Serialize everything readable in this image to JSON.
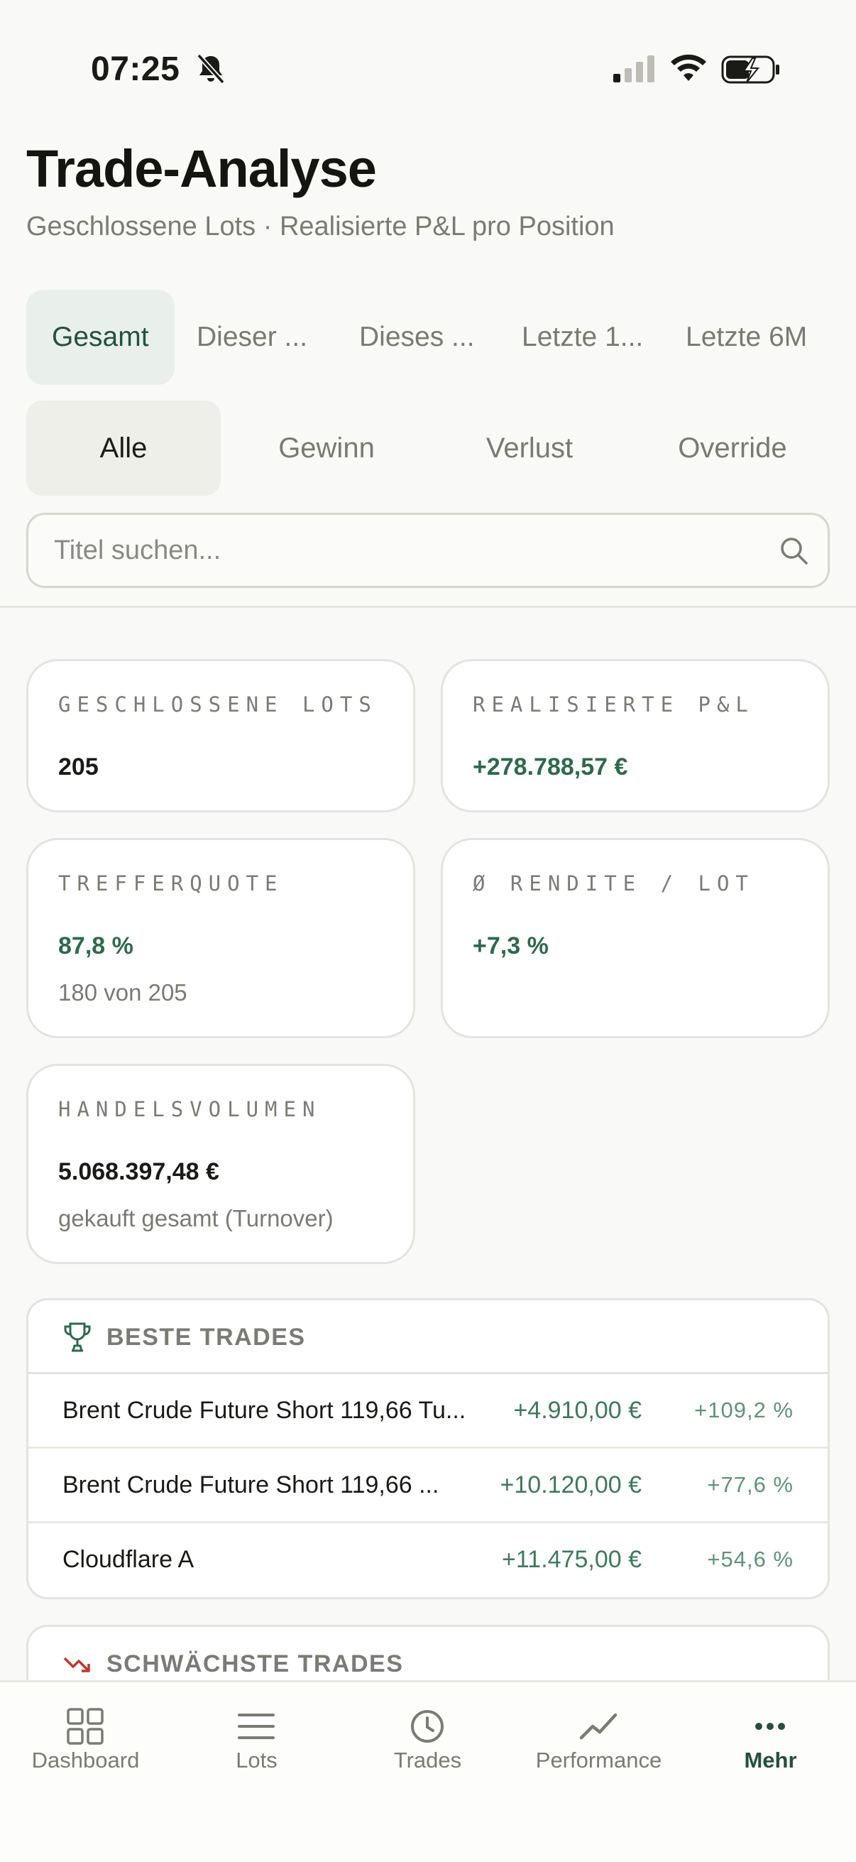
{
  "status": {
    "time": "07:25"
  },
  "header": {
    "title": "Trade-Analyse",
    "subtitle": "Geschlossene Lots · Realisierte P&L pro Position"
  },
  "period_tabs": [
    "Gesamt",
    "Dieser ...",
    "Dieses ...",
    "Letzte 1...",
    "Letzte 6M"
  ],
  "filter_tabs": [
    "Alle",
    "Gewinn",
    "Verlust",
    "Override"
  ],
  "search": {
    "placeholder": "Titel suchen..."
  },
  "stats": {
    "closed_lots": {
      "label": "GESCHLOSSENE LOTS",
      "value": "205"
    },
    "realized_pl": {
      "label": "REALISIERTE P&L",
      "value": "+278.788,57 €"
    },
    "hit_rate": {
      "label": "TREFFERQUOTE",
      "value": "87,8 %",
      "sub": "180 von 205"
    },
    "avg_return": {
      "label": "Ø RENDITE / LOT",
      "value": "+7,3 %"
    },
    "volume": {
      "label": "HANDELSVOLUMEN",
      "value": "5.068.397,48 €",
      "sub": "gekauft gesamt (Turnover)"
    }
  },
  "best_trades": {
    "title": "BESTE TRADES",
    "rows": [
      {
        "name": "Brent Crude Future Short 119,66 Tu...",
        "pl": "+4.910,00 €",
        "pct": "+109,2 %"
      },
      {
        "name": "Brent Crude Future Short 119,66 ...",
        "pl": "+10.120,00 €",
        "pct": "+77,6 %"
      },
      {
        "name": "Cloudflare A",
        "pl": "+11.475,00 €",
        "pct": "+54,6 %"
      }
    ]
  },
  "worst_trades": {
    "title": "SCHWÄCHSTE TRADES"
  },
  "nav": [
    "Dashboard",
    "Lots",
    "Trades",
    "Performance",
    "Mehr"
  ],
  "colors": {
    "accent": "#24503d",
    "positive": "#2e6a4d",
    "negative": "#c0392b"
  }
}
